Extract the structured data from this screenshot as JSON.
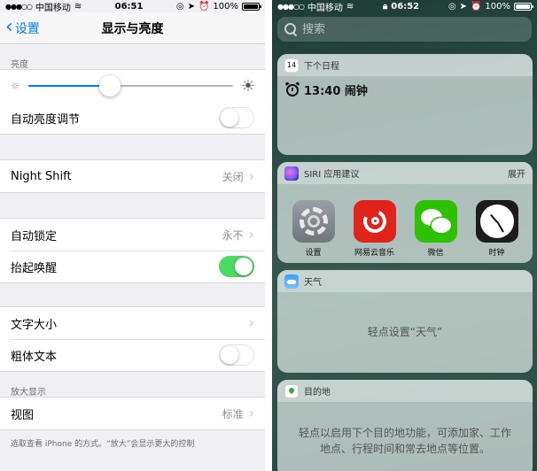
{
  "left": {
    "status": {
      "carrier": "中国移动",
      "time": "06:51",
      "battery": "100%"
    },
    "nav": {
      "back_label": "设置",
      "title": "显示与亮度"
    },
    "brightness": {
      "section_label": "亮度",
      "level_percent": 40
    },
    "auto_brightness": {
      "label": "自动亮度调节",
      "on": false
    },
    "night_shift": {
      "label": "Night Shift",
      "value": "关闭"
    },
    "auto_lock": {
      "label": "自动锁定",
      "value": "永不"
    },
    "raise_to_wake": {
      "label": "抬起唤醒",
      "on": true
    },
    "text_size": {
      "label": "文字大小"
    },
    "bold_text": {
      "label": "粗体文本",
      "on": false
    },
    "zoom": {
      "section_label": "放大显示",
      "view_label": "视图",
      "view_value": "标准"
    },
    "footer_note": "选取查看 iPhone 的方式。“放大”会显示更大的控制"
  },
  "right": {
    "status": {
      "carrier": "中国移动",
      "time": "06:52",
      "battery": "100%"
    },
    "search": {
      "placeholder": "搜索"
    },
    "upnext": {
      "title": "下个日程",
      "cal_day": "14",
      "event": "13:40 闹钟"
    },
    "siri": {
      "title": "SIRI 应用建议",
      "action": "展开",
      "apps": [
        {
          "name": "设置"
        },
        {
          "name": "网易云音乐"
        },
        {
          "name": "微信"
        },
        {
          "name": "时钟"
        }
      ]
    },
    "weather": {
      "title": "天气",
      "message": "轻点设置“天气”"
    },
    "destinations": {
      "title": "目的地",
      "message": "轻点以启用下个目的地功能，可添加家、工作地点、行程时间和常去地点等位置。"
    }
  }
}
